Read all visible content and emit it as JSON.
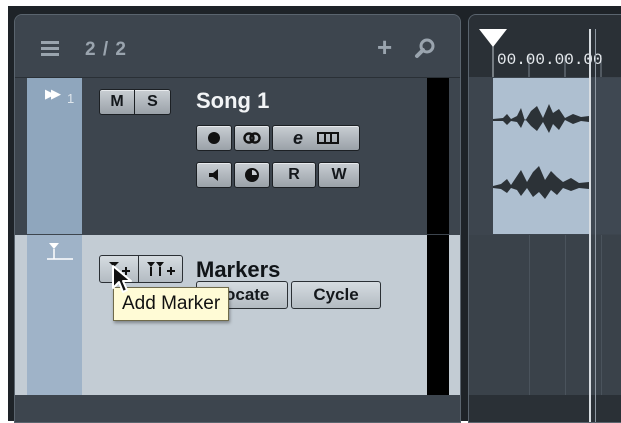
{
  "tracklist": {
    "count": "2 / 2",
    "tracks": [
      {
        "number": "1",
        "name": "Song 1",
        "buttons": {
          "mute": "M",
          "solo": "S",
          "read": "R",
          "write": "W"
        }
      },
      {
        "name": "Markers",
        "buttons": {
          "locate": "Locate",
          "cycle": "Cycle"
        }
      }
    ]
  },
  "tooltip": {
    "text": "Add Marker"
  },
  "ruler": {
    "timecode": "00.00.00.00"
  },
  "colors": {
    "panel_bg": "#3d454e",
    "track_strip": "#8fa6bd",
    "marker_track_bg": "#c3ccd4",
    "audio_event": "#aebfd0",
    "tooltip_bg": "#fffbd6"
  },
  "icons": [
    "list-icon",
    "add-icon",
    "search-icon",
    "playhead-icon",
    "expand-icon",
    "record-icon",
    "monitor-icon",
    "edit-icon",
    "lanes-icon",
    "speaker-icon",
    "clock-icon",
    "marker-track-icon",
    "add-marker-icon",
    "add-cycle-marker-icon",
    "mouse-cursor-icon"
  ]
}
